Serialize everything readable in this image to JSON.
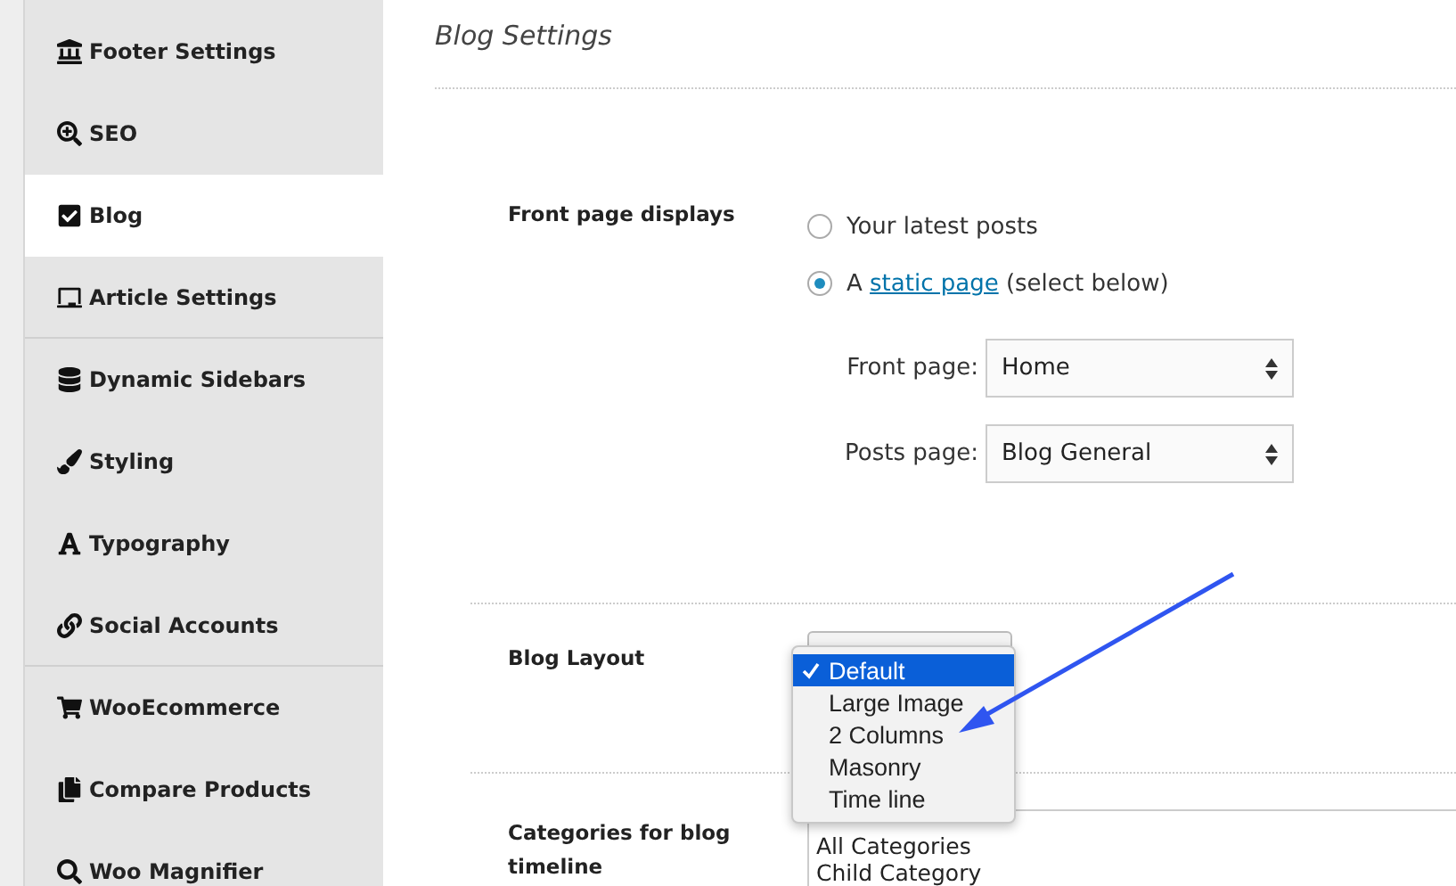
{
  "sidebar": {
    "items": [
      {
        "label": "Footer Settings",
        "selected": false
      },
      {
        "label": "SEO",
        "selected": false
      },
      {
        "label": "Blog",
        "selected": true
      },
      {
        "label": "Article Settings",
        "selected": false
      },
      {
        "label": "Dynamic Sidebars",
        "selected": false
      },
      {
        "label": "Styling",
        "selected": false
      },
      {
        "label": "Typography",
        "selected": false
      },
      {
        "label": "Social Accounts",
        "selected": false
      },
      {
        "label": "WooEcommerce",
        "selected": false
      },
      {
        "label": "Compare Products",
        "selected": false
      },
      {
        "label": "Woo Magnifier",
        "selected": false
      }
    ]
  },
  "title": "Blog Settings",
  "front_page": {
    "label": "Front page displays",
    "options": [
      {
        "text": "Your latest posts",
        "selected": false
      },
      {
        "text": "A ",
        "link": "static page",
        "after": " (select below)",
        "selected": true
      }
    ],
    "selects": [
      {
        "label": "Front page:",
        "value": "Home"
      },
      {
        "label": "Posts page:",
        "value": "Blog General"
      }
    ]
  },
  "blog_layout": {
    "label": "Blog Layout",
    "options": [
      {
        "text": "Default",
        "selected": true
      },
      {
        "text": "Large Image",
        "selected": false
      },
      {
        "text": "2 Columns",
        "selected": false
      },
      {
        "text": "Masonry",
        "selected": false
      },
      {
        "text": "Time line",
        "selected": false
      }
    ]
  },
  "categories": {
    "label": "Categories for blog timeline",
    "items": [
      "All Categories",
      "Child Category"
    ]
  }
}
